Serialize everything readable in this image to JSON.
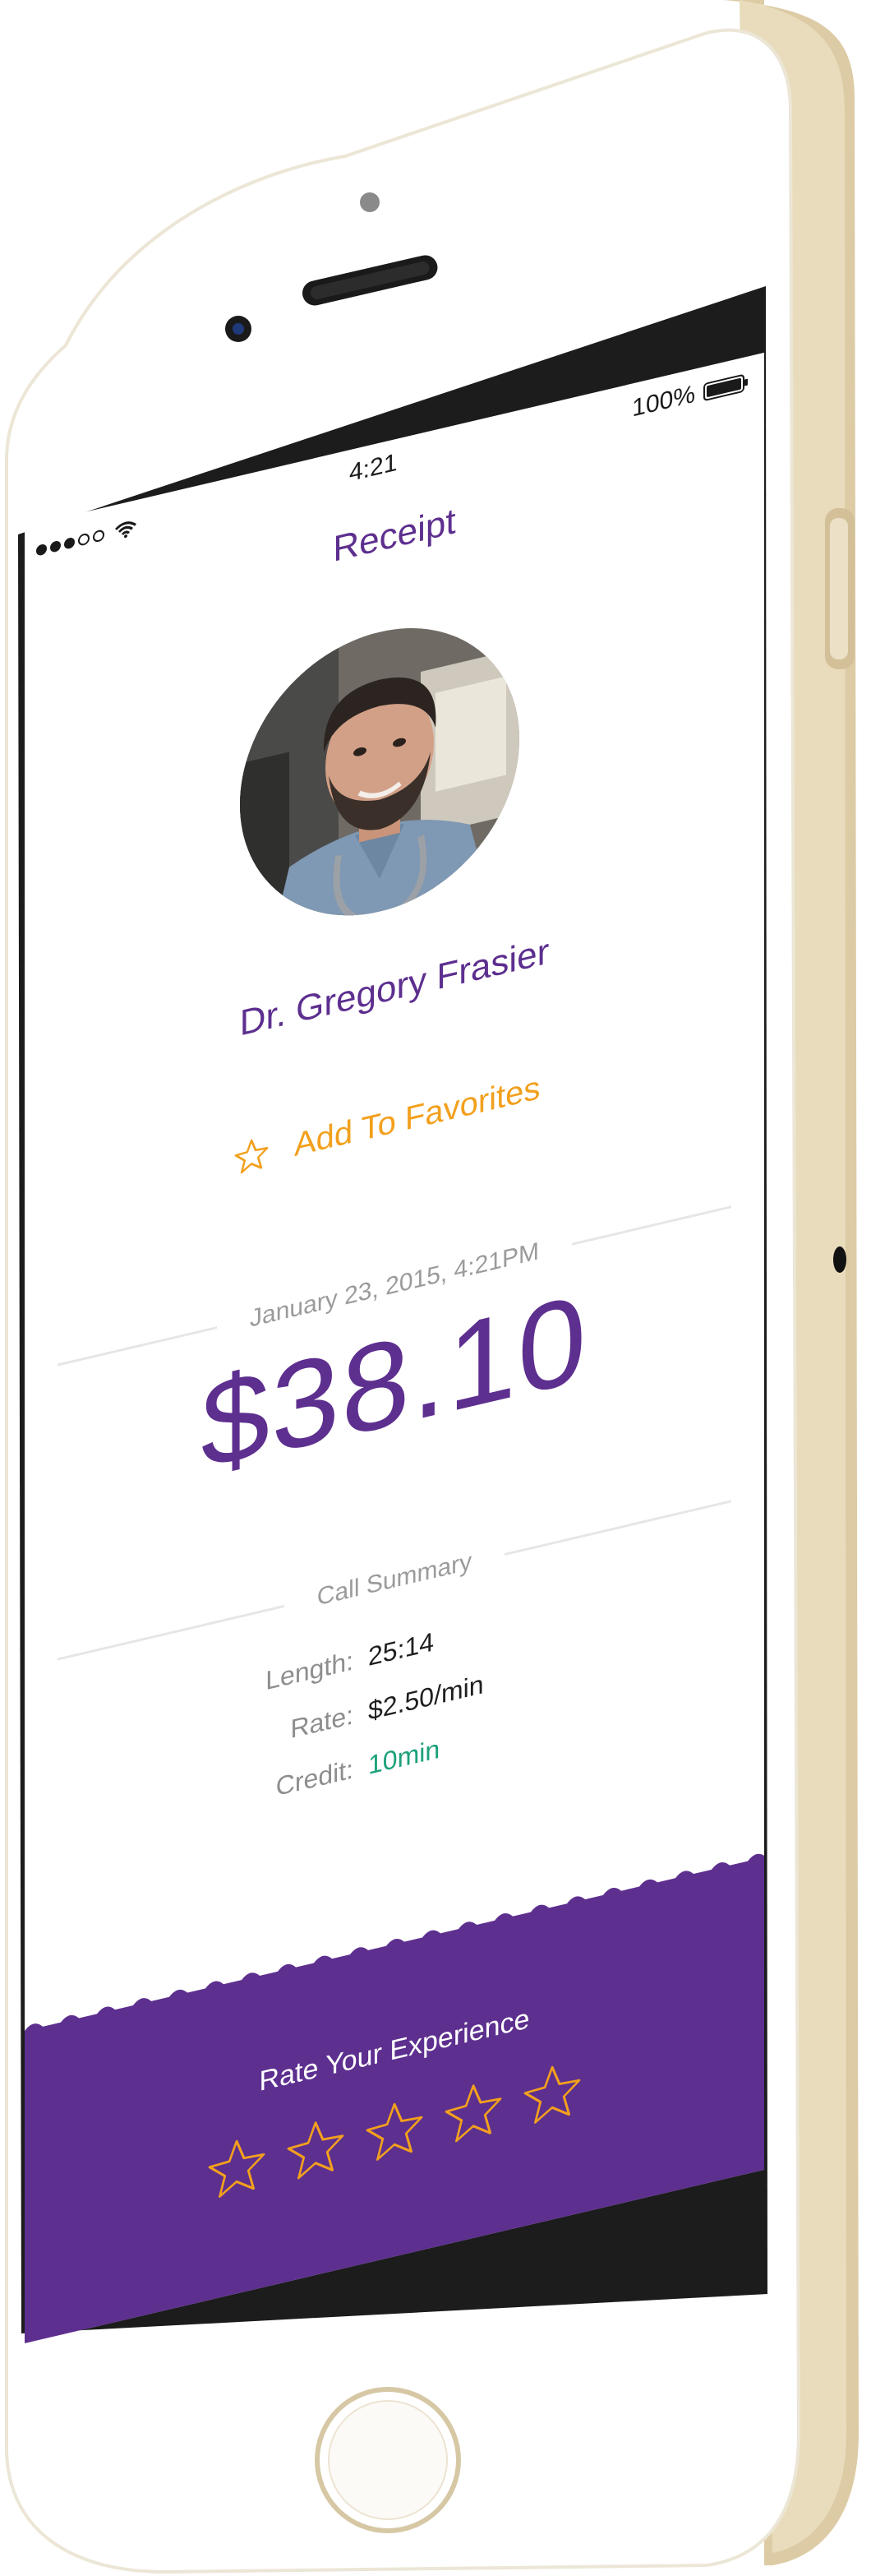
{
  "status_bar": {
    "time": "4:21",
    "battery_percent": "100%",
    "signal_bars_filled": 3,
    "signal_bars_total": 5
  },
  "nav": {
    "title": "Receipt"
  },
  "doctor": {
    "name": "Dr. Gregory Frasier"
  },
  "favorites": {
    "label": "Add To Favorites",
    "icon": "star-outline-icon"
  },
  "receipt": {
    "datetime": "January 23, 2015, 4:21PM",
    "amount": "$38.10",
    "summary_heading": "Call Summary",
    "rows": [
      {
        "key": "Length:",
        "value": "25:14"
      },
      {
        "key": "Rate:",
        "value": "$2.50/min"
      },
      {
        "key": "Credit:",
        "value": "10min"
      }
    ]
  },
  "rating": {
    "title": "Rate Your Experience",
    "max_stars": 5,
    "selected_stars": 0
  },
  "colors": {
    "purple": "#5d2f8f",
    "orange": "#f2a01d",
    "green": "#1ca07a",
    "gray_text": "#9b9b9b",
    "phone_gold": "#d9c79f"
  }
}
